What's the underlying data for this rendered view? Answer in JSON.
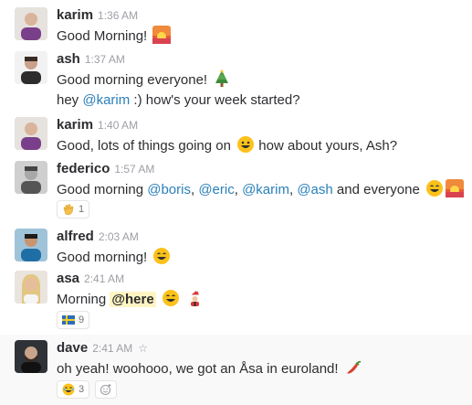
{
  "messages": [
    {
      "id": "m1",
      "user": "karim",
      "time": "1:36 AM",
      "lines": [
        {
          "parts": [
            {
              "text": "Good Morning! "
            }
          ],
          "emoji": [
            "sunrise"
          ]
        }
      ]
    },
    {
      "id": "m2",
      "user": "ash",
      "time": "1:37 AM",
      "lines": [
        {
          "parts": [
            {
              "text": "Good morning everyone! "
            }
          ],
          "emoji": [
            "christmas-tree"
          ]
        },
        {
          "parts": [
            {
              "text": "hey "
            },
            {
              "mention": "@karim"
            },
            {
              "text": " :) how's your week started?"
            }
          ]
        }
      ]
    },
    {
      "id": "m3",
      "user": "karim",
      "time": "1:40 AM",
      "lines": [
        {
          "parts": [
            {
              "text": "Good, lots of things going on "
            }
          ],
          "tail": " how about yours, Ash?"
        }
      ]
    },
    {
      "id": "m4",
      "user": "federico",
      "time": "1:57 AM",
      "lines": [
        {
          "parts": [
            {
              "text": "Good morning "
            },
            {
              "mention": "@boris"
            },
            {
              "text": ", "
            },
            {
              "mention": "@eric"
            },
            {
              "text": ", "
            },
            {
              "mention": "@karim"
            },
            {
              "text": ", "
            },
            {
              "mention": "@ash"
            },
            {
              "text": "  and everyone "
            }
          ]
        }
      ],
      "reaction": {
        "emoji": "clap",
        "count": "1"
      }
    },
    {
      "id": "m5",
      "user": "alfred",
      "time": "2:03 AM",
      "lines": [
        {
          "parts": [
            {
              "text": "Good morning! "
            }
          ]
        }
      ]
    },
    {
      "id": "m6",
      "user": "asa",
      "time": "2:41 AM",
      "lines": [
        {
          "parts": [
            {
              "text": "Morning "
            },
            {
              "here": "@here"
            }
          ]
        }
      ],
      "reaction": {
        "emoji": "flag-sweden",
        "count": "9"
      }
    },
    {
      "id": "m7",
      "user": "dave",
      "time": "2:41 AM",
      "lines": [
        {
          "parts": [
            {
              "text": "oh yeah! woohooo, we got an Åsa in euroland! "
            }
          ]
        }
      ],
      "reaction": {
        "emoji": "joy",
        "count": "3"
      }
    }
  ],
  "colors": {
    "mention": "#2a80b9",
    "here_bg": "#fff4c2",
    "time": "#9e9ea6",
    "hover_bg": "#f9f9f9"
  }
}
